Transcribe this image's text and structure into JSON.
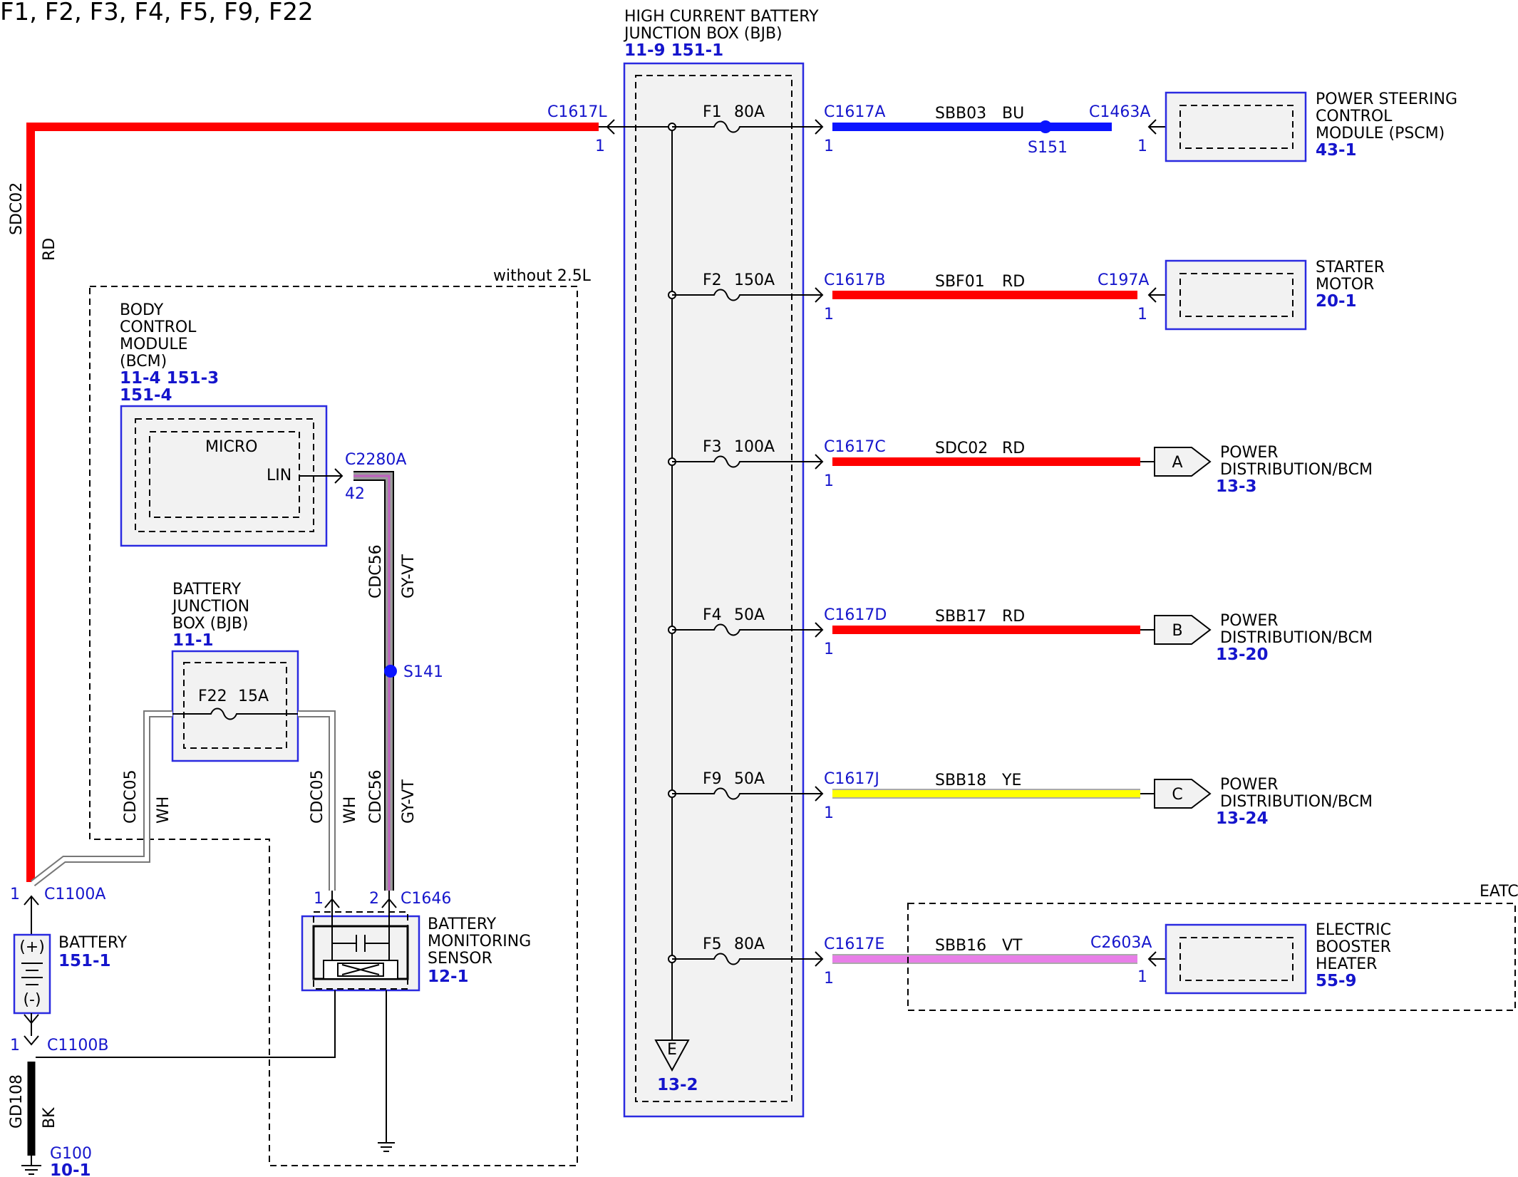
{
  "title": "F1, F2, F3, F4, F5, F9, F22",
  "hcbjb": {
    "name_line1": "HIGH CURRENT BATTERY",
    "name_line2": "JUNCTION BOX (BJB)",
    "refs": "11-9   151-1",
    "ground_ref": "13-2",
    "ground_label": "E",
    "input_connector": "C1617L",
    "input_pin": "1",
    "fuses": [
      {
        "fuse": "F1",
        "rating": "80A",
        "connector": "C1617A",
        "pin": "1",
        "circuit": "SBB03",
        "color_code": "BU",
        "wire_color": "#0a14ff"
      },
      {
        "fuse": "F2",
        "rating": "150A",
        "connector": "C1617B",
        "pin": "1",
        "circuit": "SBF01",
        "color_code": "RD",
        "wire_color": "#ff0000"
      },
      {
        "fuse": "F3",
        "rating": "100A",
        "connector": "C1617C",
        "pin": "1",
        "circuit": "SDC02",
        "color_code": "RD",
        "wire_color": "#ff0000"
      },
      {
        "fuse": "F4",
        "rating": "50A",
        "connector": "C1617D",
        "pin": "1",
        "circuit": "SBB17",
        "color_code": "RD",
        "wire_color": "#ff0000"
      },
      {
        "fuse": "F9",
        "rating": "50A",
        "connector": "C1617J",
        "pin": "1",
        "circuit": "SBB18",
        "color_code": "YE",
        "wire_color": "#ffff00"
      },
      {
        "fuse": "F5",
        "rating": "80A",
        "connector": "C1617E",
        "pin": "1",
        "circuit": "SBB16",
        "color_code": "VT",
        "wire_color": "#e87ee8"
      }
    ]
  },
  "pscm": {
    "name_line1": "POWER STEERING",
    "name_line2": "CONTROL",
    "name_line3": "MODULE (PSCM)",
    "ref": "43-1",
    "connector": "C1463A",
    "pin": "1",
    "splice": "S151"
  },
  "starter": {
    "name_line1": "STARTER",
    "name_line2": "MOTOR",
    "ref": "20-1",
    "connector": "C197A",
    "pin": "1"
  },
  "power_dist": [
    {
      "flag": "A",
      "name_line1": "POWER",
      "name_line2": "DISTRIBUTION/BCM",
      "ref": "13-3"
    },
    {
      "flag": "B",
      "name_line1": "POWER",
      "name_line2": "DISTRIBUTION/BCM",
      "ref": "13-20"
    },
    {
      "flag": "C",
      "name_line1": "POWER",
      "name_line2": "DISTRIBUTION/BCM",
      "ref": "13-24"
    }
  ],
  "heater": {
    "name_line1": "ELECTRIC",
    "name_line2": "BOOSTER",
    "name_line3": "HEATER",
    "ref": "55-9",
    "connector": "C2603A",
    "pin": "1",
    "option_label": "EATC"
  },
  "main_wire": {
    "circuit": "SDC02",
    "color_code": "RD"
  },
  "without_label": "without 2.5L",
  "bcm": {
    "name_line1": "BODY",
    "name_line2": "CONTROL",
    "name_line3": "MODULE",
    "name_line4": "(BCM)",
    "refs_line1": "11-4   151-3",
    "refs_line2": "151-4",
    "micro": "MICRO",
    "pin_name": "LIN",
    "connector": "C2280A",
    "pin": "42"
  },
  "lin_wire": {
    "circuit": "CDC56",
    "color_code": "GY-VT",
    "splice": "S141"
  },
  "bjb": {
    "name_line1": "BATTERY",
    "name_line2": "JUNCTION",
    "name_line3": "BOX (BJB)",
    "ref": "11-1",
    "fuse": "F22",
    "rating": "15A"
  },
  "wh_wire": {
    "circuit": "CDC05",
    "color_code": "WH"
  },
  "bms": {
    "name_line1": "BATTERY",
    "name_line2": "MONITORING",
    "name_line3": "SENSOR",
    "ref": "12-1",
    "connector": "C1646",
    "pin1": "1",
    "pin2": "2"
  },
  "battery": {
    "name": "BATTERY",
    "ref": "151-1",
    "plus": "(+)",
    "minus": "(-)",
    "connector_top": "C1100A",
    "pin_top": "1",
    "connector_bottom": "C1100B",
    "pin_bottom": "1"
  },
  "ground_wire": {
    "circuit": "GD108",
    "color_code": "BK",
    "ground": "G100",
    "ground_ref": "10-1"
  }
}
